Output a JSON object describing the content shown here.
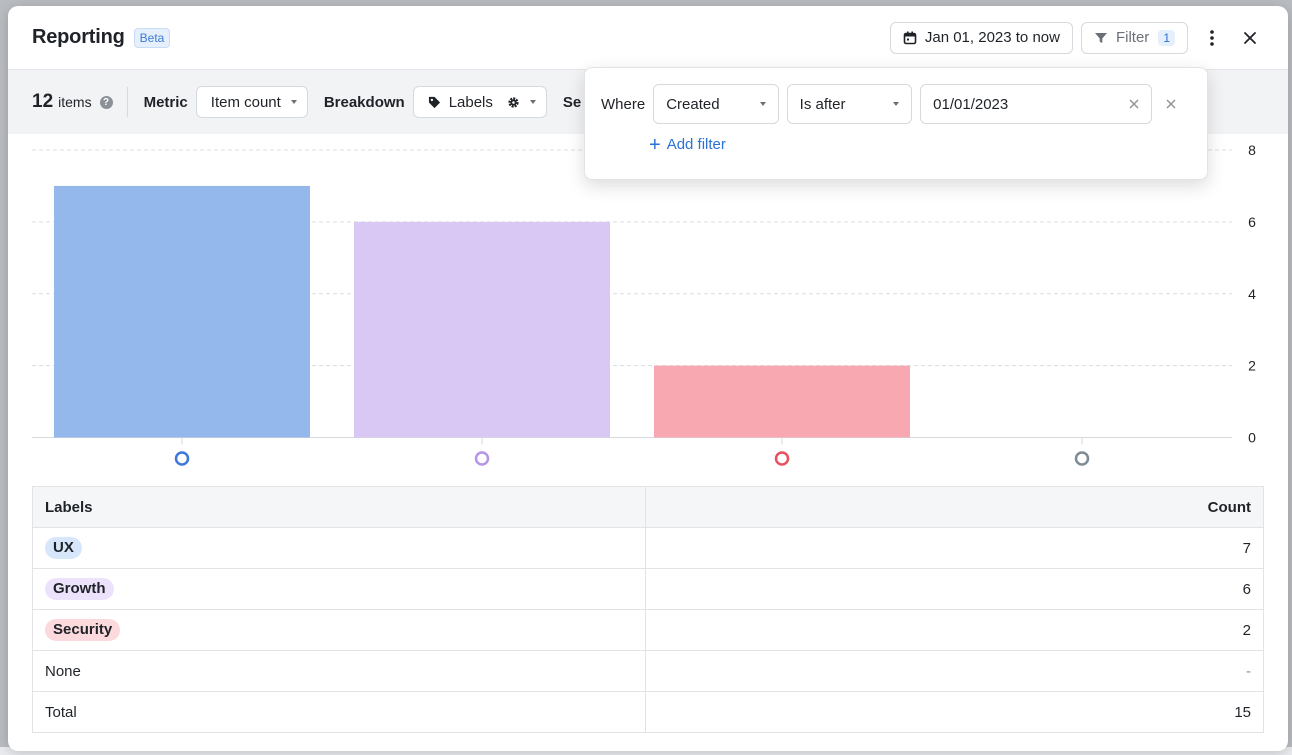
{
  "header": {
    "title": "Reporting",
    "badge": "Beta",
    "date_range": "Jan 01, 2023 to now",
    "filter_label": "Filter",
    "filter_count": "1"
  },
  "toolbar": {
    "item_count": "12",
    "item_label": "items",
    "metric_label": "Metric",
    "metric_value": "Item count",
    "breakdown_label": "Breakdown",
    "breakdown_value": "Labels",
    "truncated_label": "Se"
  },
  "filter_popover": {
    "where": "Where",
    "field": "Created",
    "operator": "Is after",
    "value": "01/01/2023",
    "add_filter": "Add filter"
  },
  "chart_data": {
    "type": "bar",
    "categories": [
      "UX",
      "Growth",
      "Security",
      "None"
    ],
    "values": [
      7,
      6,
      2,
      0
    ],
    "colors": [
      "#94b8ec",
      "#d9c8f4",
      "#f8a8b0",
      "#7e8b94"
    ],
    "marker_colors": [
      "#3d78d8",
      "#b596e6",
      "#e8505f",
      "#7e8b94"
    ],
    "y_ticks": [
      "0",
      "2",
      "4",
      "6",
      "8"
    ],
    "ylim": [
      0,
      8
    ],
    "grid": true
  },
  "table": {
    "headers": [
      "Labels",
      "Count"
    ],
    "rows": [
      {
        "label": "UX",
        "count": "7",
        "chip_bg": "#d7e7fb"
      },
      {
        "label": "Growth",
        "count": "6",
        "chip_bg": "#ece2fb"
      },
      {
        "label": "Security",
        "count": "2",
        "chip_bg": "#fcd9dc"
      },
      {
        "label": "None",
        "count": "-",
        "chip_bg": ""
      }
    ],
    "total_label": "Total",
    "total_count": "15"
  }
}
